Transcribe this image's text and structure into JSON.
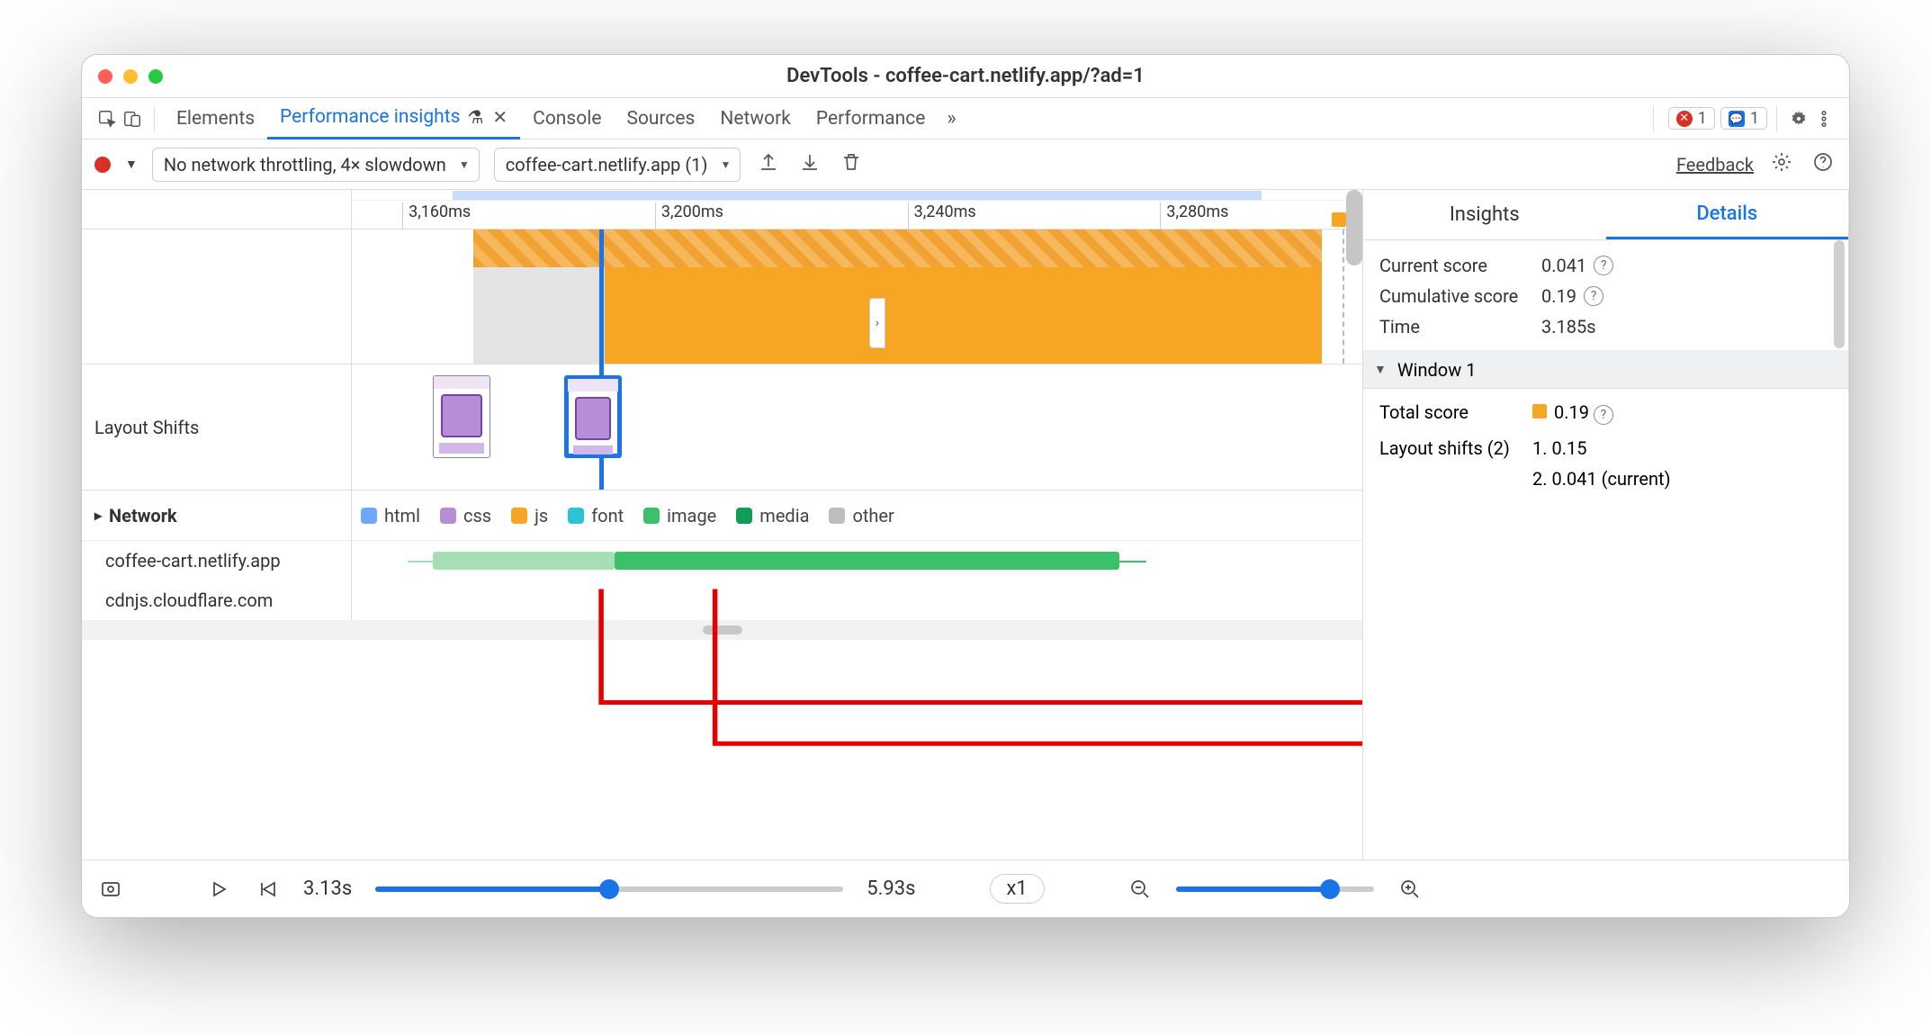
{
  "window": {
    "title": "DevTools - coffee-cart.netlify.app/?ad=1"
  },
  "tabs": {
    "items": [
      "Elements",
      "Performance insights",
      "Console",
      "Sources",
      "Network",
      "Performance"
    ],
    "activeIndex": 1,
    "errors_count": "1",
    "messages_count": "1"
  },
  "toolbar": {
    "throttling": "No network throttling, 4× slowdown",
    "page": "coffee-cart.netlify.app (1)",
    "feedback": "Feedback"
  },
  "ruler": {
    "ticks": [
      "3,160ms",
      "3,200ms",
      "3,240ms",
      "3,280ms"
    ]
  },
  "tracks": {
    "layout_shifts_label": "Layout Shifts",
    "network_label": "Network"
  },
  "legend": {
    "html": "html",
    "css": "css",
    "js": "js",
    "font": "font",
    "image": "image",
    "media": "media",
    "other": "other",
    "colors": {
      "html": "#6fa8ff",
      "css": "#b58ed6",
      "js": "#f5a623",
      "font": "#2cc3d6",
      "image": "#3cc06a",
      "media": "#0f9d58",
      "other": "#bdbdbd"
    }
  },
  "network": {
    "rows": [
      {
        "host": "coffee-cart.netlify.app"
      },
      {
        "host": "cdnjs.cloudflare.com"
      }
    ]
  },
  "details": {
    "tabs": {
      "insights": "Insights",
      "details": "Details"
    },
    "current_score_label": "Current score",
    "current_score": "0.041",
    "cumulative_score_label": "Cumulative score",
    "cumulative_score": "0.19",
    "time_label": "Time",
    "time": "3.185s",
    "window_label": "Window 1",
    "total_score_label": "Total score",
    "total_score": "0.19",
    "layout_shifts_label": "Layout shifts (2)",
    "shift1": "1. 0.15",
    "shift2": "2. 0.041 (current)"
  },
  "footer": {
    "start": "3.13s",
    "end": "5.93s",
    "speed": "x1"
  }
}
